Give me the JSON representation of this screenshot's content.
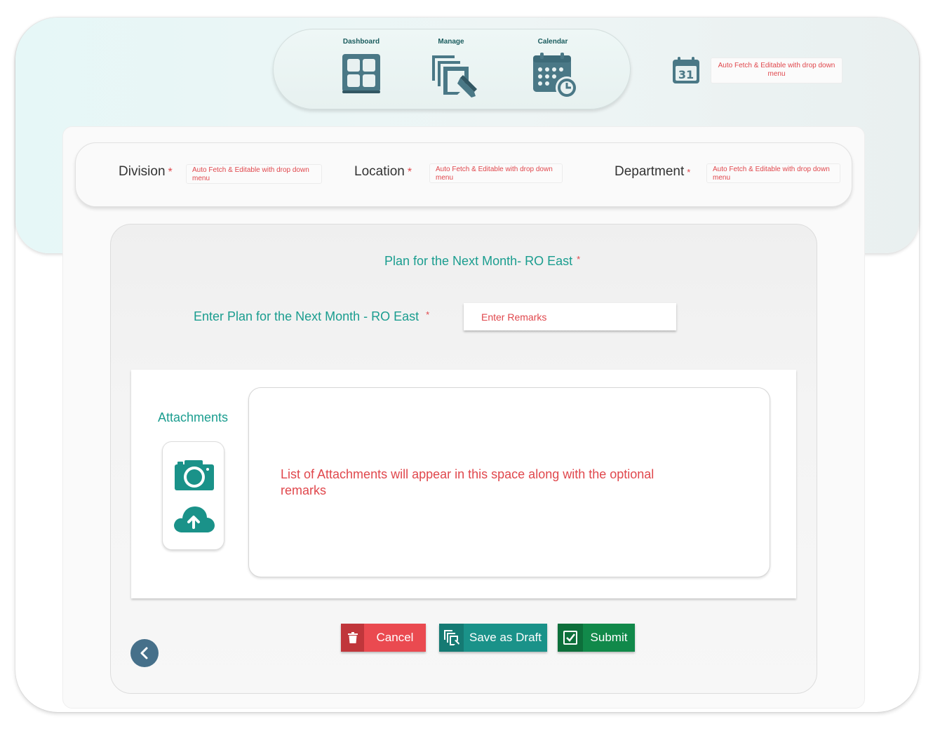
{
  "nav": {
    "items": [
      {
        "label": "Dashboard",
        "icon": "dashboard-grid-icon"
      },
      {
        "label": "Manage",
        "icon": "manage-edit-icon"
      },
      {
        "label": "Calendar",
        "icon": "calendar-clock-icon"
      }
    ]
  },
  "top": {
    "date_icon_text": "31",
    "date_field_text": "Auto Fetch & Editable with drop down menu"
  },
  "filters": {
    "division": {
      "label": "Division",
      "required": "*",
      "value": "Auto Fetch & Editable with drop down menu"
    },
    "location": {
      "label": "Location",
      "required": "*",
      "value": "Auto Fetch & Editable with drop down menu"
    },
    "department": {
      "label": "Department",
      "required": "*",
      "value": "Auto Fetch & Editable with drop down menu"
    }
  },
  "form": {
    "title": "Plan for the Next Month- RO East",
    "title_required": "*",
    "plan_label": "Enter Plan for the Next Month - RO East",
    "plan_required": "*",
    "remarks_placeholder": "Enter Remarks"
  },
  "attachments": {
    "label": "Attachments",
    "placeholder": "List of Attachments will appear in this space along with the optional remarks"
  },
  "actions": {
    "cancel": "Cancel",
    "save_draft": "Save as Draft",
    "submit": "Submit"
  },
  "colors": {
    "accent_teal": "#1a9d8f",
    "danger_red": "#e0474c",
    "submit_green": "#11894a",
    "icon_slate": "#4a7886"
  }
}
